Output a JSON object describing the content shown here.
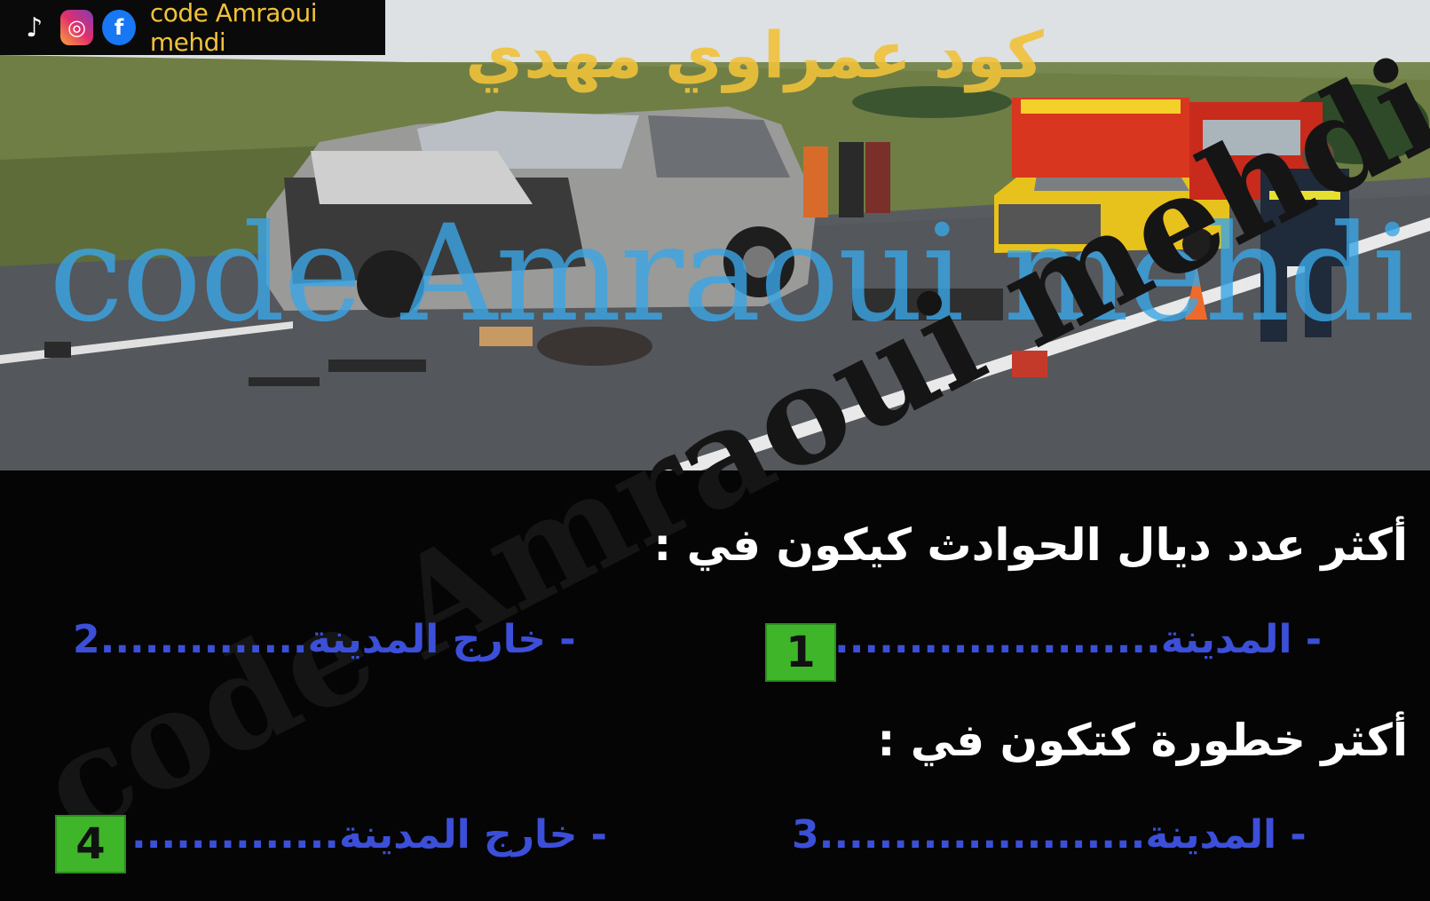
{
  "branding": {
    "channel_text": "code Amraoui mehdi",
    "icons": [
      "tiktok-icon",
      "instagram-icon",
      "facebook-icon"
    ],
    "arabic_watermark": "كود عمراوي مهدي",
    "latin_watermark": "code Amraoui mehdi",
    "dark_watermark": "code Amraoui mehdi",
    "colors": {
      "gold": "#f0c23a",
      "blue_text": "#3b4fd8",
      "badge_green": "#3fb52a",
      "watermark_blue": "#3aa6e6"
    }
  },
  "questions": [
    {
      "text": "أكثر عدد ديال الحوادث كيكون في :",
      "options": [
        {
          "label": "- المدينة",
          "dots": "......................",
          "number": "1",
          "highlighted": true
        },
        {
          "label": "- خارج المدينة",
          "dots": "..............",
          "number": "2",
          "highlighted": false
        }
      ]
    },
    {
      "text": "أكثر خطورة كتكون في :",
      "options": [
        {
          "label": "- المدينة",
          "dots": "......................",
          "number": "3",
          "highlighted": false
        },
        {
          "label": "- خارج المدينة",
          "dots": "..............",
          "number": "4",
          "highlighted": true
        }
      ]
    }
  ]
}
